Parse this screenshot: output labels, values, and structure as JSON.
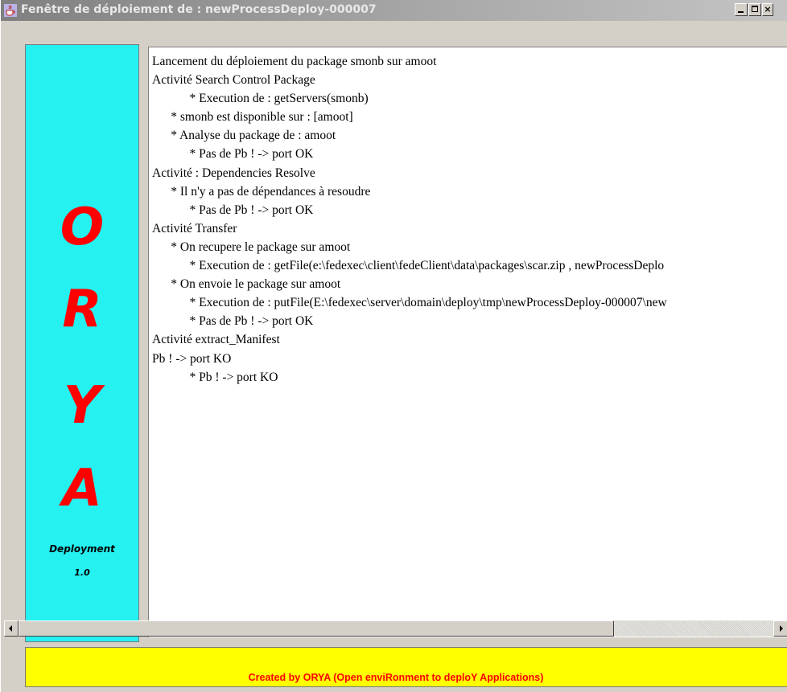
{
  "window": {
    "title": "Fenêtre de déploiement de : newProcessDeploy-000007",
    "icon": "java-cup-icon",
    "buttons": {
      "minimize": "_",
      "maximize": "□",
      "close": "×"
    }
  },
  "logo": {
    "letters": [
      "O",
      "R",
      "Y",
      "A"
    ],
    "caption": "Deployment",
    "version": "1.0",
    "background": "#25f1f1",
    "letter_color": "#ff0000"
  },
  "log": {
    "lines": [
      "Lancement du déploiement du package smonb sur amoot",
      "Activité Search Control Package",
      "            * Execution de : getServers(smonb)",
      "      * smonb est disponible sur : [amoot]",
      "      * Analyse du package de : amoot",
      "            * Pas de Pb ! -> port OK",
      "Activité : Dependencies Resolve",
      "      * Il n'y a pas de dépendances à resoudre",
      "            * Pas de Pb ! -> port OK",
      "Activité Transfer",
      "      * On recupere le package sur amoot",
      "            * Execution de : getFile(e:\\fedexec\\client\\fedeClient\\data\\packages\\scar.zip , newProcessDeplo",
      "      * On envoie le package sur amoot",
      "            * Execution de : putFile(E:\\fedexec\\server\\domain\\deploy\\tmp\\newProcessDeploy-000007\\new",
      "            * Pas de Pb ! -> port OK",
      "Activité extract_Manifest",
      "Pb ! -> port KO",
      "            * Pb ! -> port KO"
    ]
  },
  "footer": {
    "text": "Created by ORYA (Open enviRonment to deploY Applications)",
    "background": "#ffff00",
    "text_color": "#ff0000"
  }
}
